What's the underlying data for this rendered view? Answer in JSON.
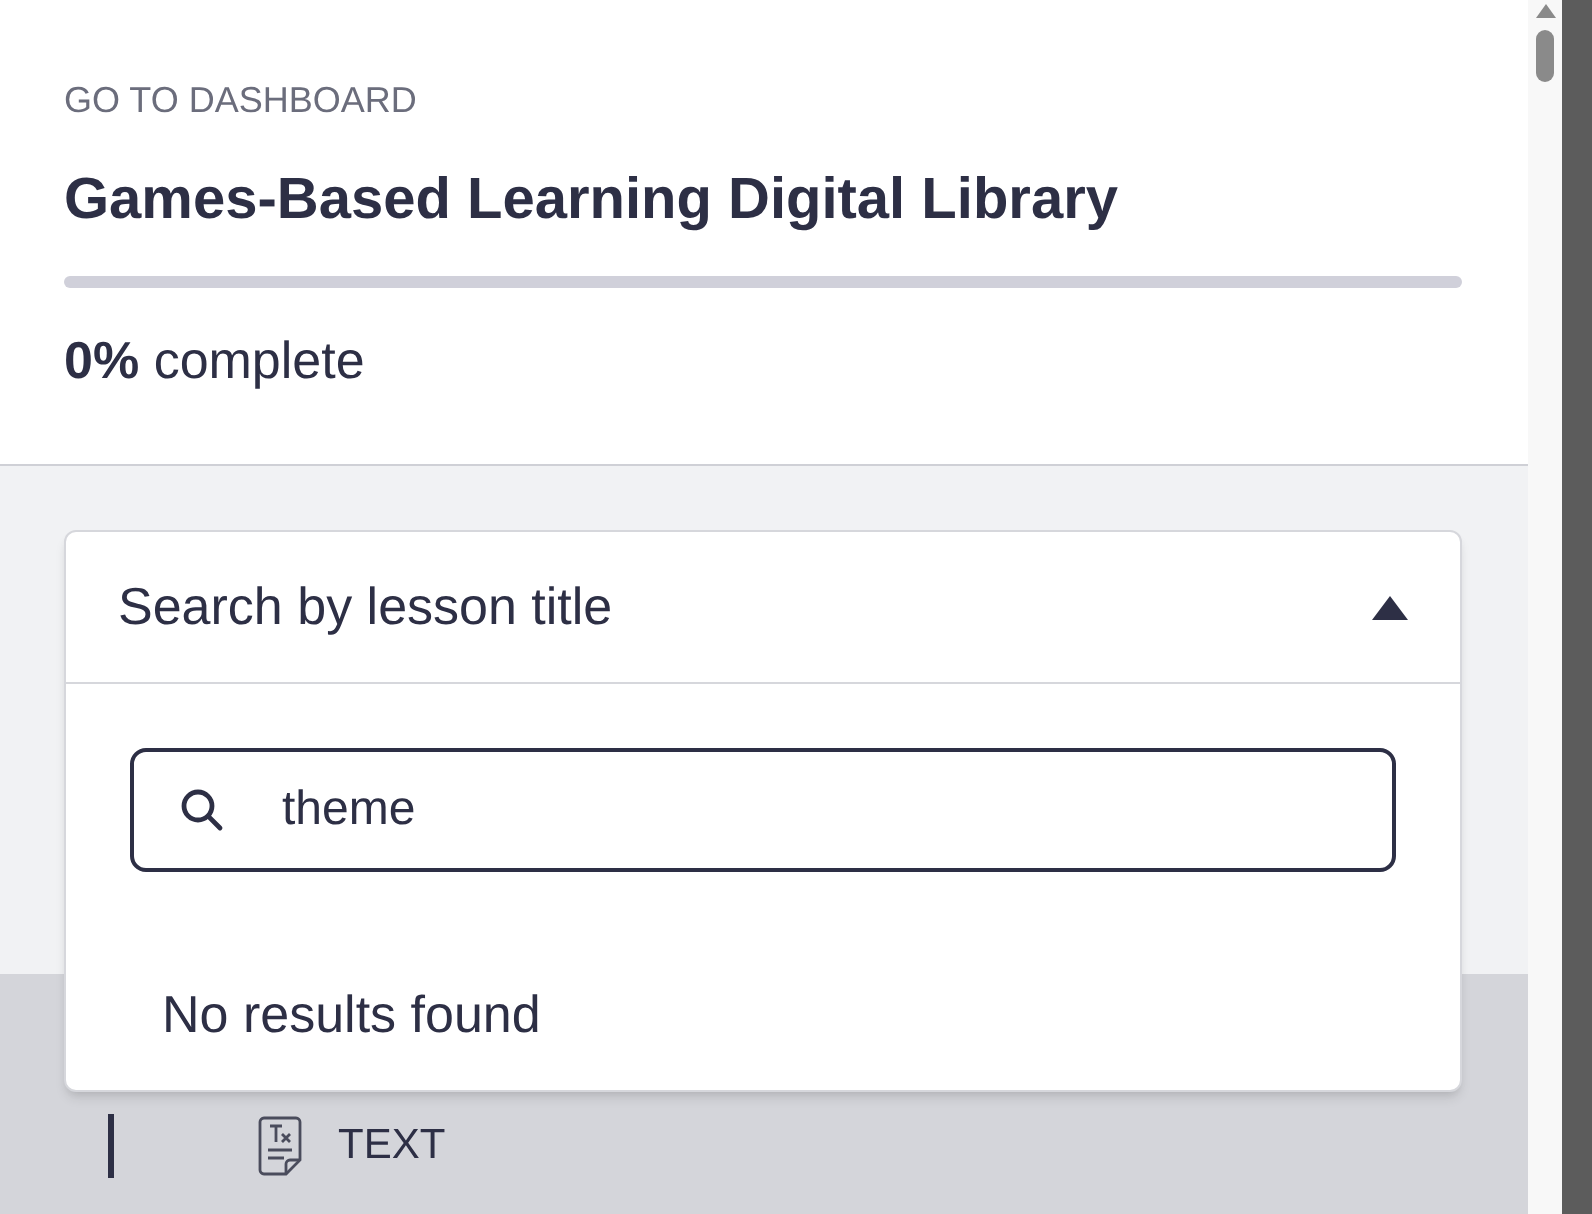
{
  "back_link": "GO TO DASHBOARD",
  "course_title": "Games-Based Learning Digital Library",
  "progress": {
    "level": 0,
    "percent": "0%",
    "label": "complete"
  },
  "lesson_search": {
    "title": "Search by lesson title",
    "expanded": true,
    "query": "theme",
    "message": "No results found"
  },
  "lesson_items": [
    {
      "label": "TEXT"
    }
  ]
}
